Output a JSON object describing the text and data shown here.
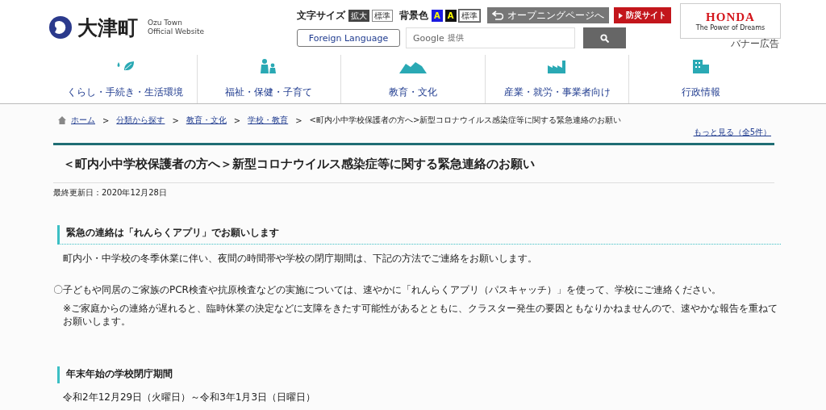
{
  "site": {
    "name": "大津町",
    "sub_en_1": "Ozu Town",
    "sub_en_2": "Official Website"
  },
  "font_size": {
    "label": "文字サイズ",
    "options": [
      {
        "label": "拡大",
        "selected": true
      },
      {
        "label": "標準",
        "selected": false
      }
    ]
  },
  "bg_color": {
    "label": "背景色",
    "options": [
      {
        "label": "A",
        "kind": "blue",
        "selected": false
      },
      {
        "label": "A",
        "kind": "black",
        "selected": false
      },
      {
        "label": "標準",
        "kind": "standard",
        "selected": true
      }
    ]
  },
  "opening_button": "オープニングページへ",
  "disaster_button": "防災サイト",
  "foreign_button": "Foreign Language",
  "search": {
    "placeholder_brand": "Google",
    "placeholder": "提供"
  },
  "banner": {
    "brand": "HONDA",
    "tagline": "The Power of Dreams",
    "caption": "バナー広告"
  },
  "nav": [
    {
      "label": "くらし・手続き・生活環境"
    },
    {
      "label": "福祉・保健・子育て"
    },
    {
      "label": "教育・文化"
    },
    {
      "label": "産業・就労・事業者向け"
    },
    {
      "label": "行政情報"
    }
  ],
  "breadcrumb_separator": ">",
  "breadcrumb": [
    {
      "label": "ホーム",
      "link": true
    },
    {
      "label": "分類から探す",
      "link": true
    },
    {
      "label": "教育・文化",
      "link": true
    },
    {
      "label": "学校・教育",
      "link": true
    },
    {
      "label": "<町内小中学校保護者の方へ>新型コロナウイルス感染症等に関する緊急連絡のお願い",
      "link": false
    }
  ],
  "more_link": "もっと見る（全5件）",
  "title": "＜町内小中学校保護者の方へ＞新型コロナウイルス感染症等に関する緊急連絡のお願い",
  "updated": "最終更新日：2020年12月28日",
  "sections": [
    {
      "heading": "緊急の連絡は「れんらくアプリ」でお願いします",
      "kind": "main",
      "paragraphs": [
        {
          "text": "町内小・中学校の冬季休業に伴い、夜間の時間帯や学校の閉庁期間は、下記の方法でご連絡をお願いします。",
          "kind": "plain"
        },
        {
          "text": "〇子どもや同居のご家族のPCR検査や抗原検査などの実施については、速やかに「れんらくアプリ（パスキャッチ）」を使って、学校にご連絡ください。",
          "kind": "bullet"
        },
        {
          "text": "※ご家庭からの連絡が遅れると、臨時休業の決定などに支障をきたす可能性があるとともに、クラスター発生の要因ともなりかねませんので、速やかな報告を重ねてお願いします。",
          "kind": "note"
        }
      ]
    },
    {
      "heading": "年末年始の学校閉庁期間",
      "kind": "sub",
      "paragraphs": [
        {
          "text": "令和2年12月29日（火曜日）～令和3年1月3日（日曜日）",
          "kind": "plain"
        }
      ]
    }
  ]
}
